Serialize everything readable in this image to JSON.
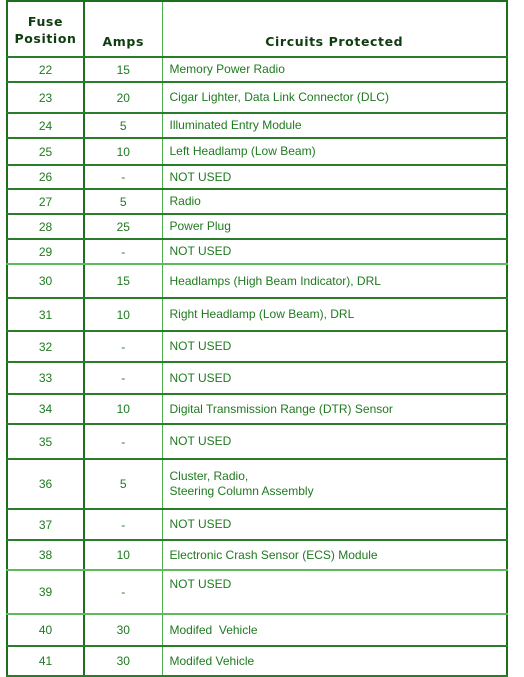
{
  "table": {
    "headers": {
      "position_line1": "Fuse",
      "position_line2": "Position",
      "amps": "Amps",
      "circuits": "Circuits Protected"
    },
    "rows": [
      {
        "position": "22",
        "amps": "15",
        "circuits": [
          "Memory Power Radio"
        ]
      },
      {
        "position": "23",
        "amps": "20",
        "circuits": [
          "Cigar Lighter, Data Link Connector (DLC)"
        ]
      },
      {
        "position": "24",
        "amps": "5",
        "circuits": [
          "Illuminated Entry Module"
        ]
      },
      {
        "position": "25",
        "amps": "10",
        "circuits": [
          "Left Headlamp (Low Beam)"
        ]
      },
      {
        "position": "26",
        "amps": "-",
        "circuits": [
          "NOT USED"
        ]
      },
      {
        "position": "27",
        "amps": "5",
        "circuits": [
          "Radio"
        ]
      },
      {
        "position": "28",
        "amps": "25",
        "circuits": [
          "Power Plug"
        ]
      },
      {
        "position": "29",
        "amps": "-",
        "circuits": [
          "NOT USED"
        ]
      },
      {
        "position": "30",
        "amps": "15",
        "circuits": [
          "Headlamps (High Beam Indicator), DRL"
        ]
      },
      {
        "position": "31",
        "amps": "10",
        "circuits": [
          "Right Headlamp (Low Beam), DRL"
        ]
      },
      {
        "position": "32",
        "amps": "-",
        "circuits": [
          "NOT USED"
        ]
      },
      {
        "position": "33",
        "amps": "-",
        "circuits": [
          "NOT USED"
        ]
      },
      {
        "position": "34",
        "amps": "10",
        "circuits": [
          "Digital Transmission Range (DTR) Sensor"
        ]
      },
      {
        "position": "35",
        "amps": "-",
        "circuits": [
          "NOT USED"
        ]
      },
      {
        "position": "36",
        "amps": "5",
        "circuits": [
          "Cluster, Radio,",
          "Steering Column Assembly"
        ]
      },
      {
        "position": "37",
        "amps": "-",
        "circuits": [
          "NOT USED"
        ]
      },
      {
        "position": "38",
        "amps": "10",
        "circuits": [
          "Electronic Crash Sensor (ECS) Module"
        ]
      },
      {
        "position": "39",
        "amps": "-",
        "circuits": [
          "NOT USED"
        ]
      },
      {
        "position": "40",
        "amps": "30",
        "circuits": [
          "Modifed  Vehicle"
        ]
      },
      {
        "position": "41",
        "amps": "30",
        "circuits": [
          "Modifed Vehicle"
        ]
      }
    ]
  },
  "colors": {
    "border_dark": "#1d6e1d",
    "border_light": "#4fae4f",
    "text": "#1f7a1f",
    "header_text": "#103d10"
  }
}
